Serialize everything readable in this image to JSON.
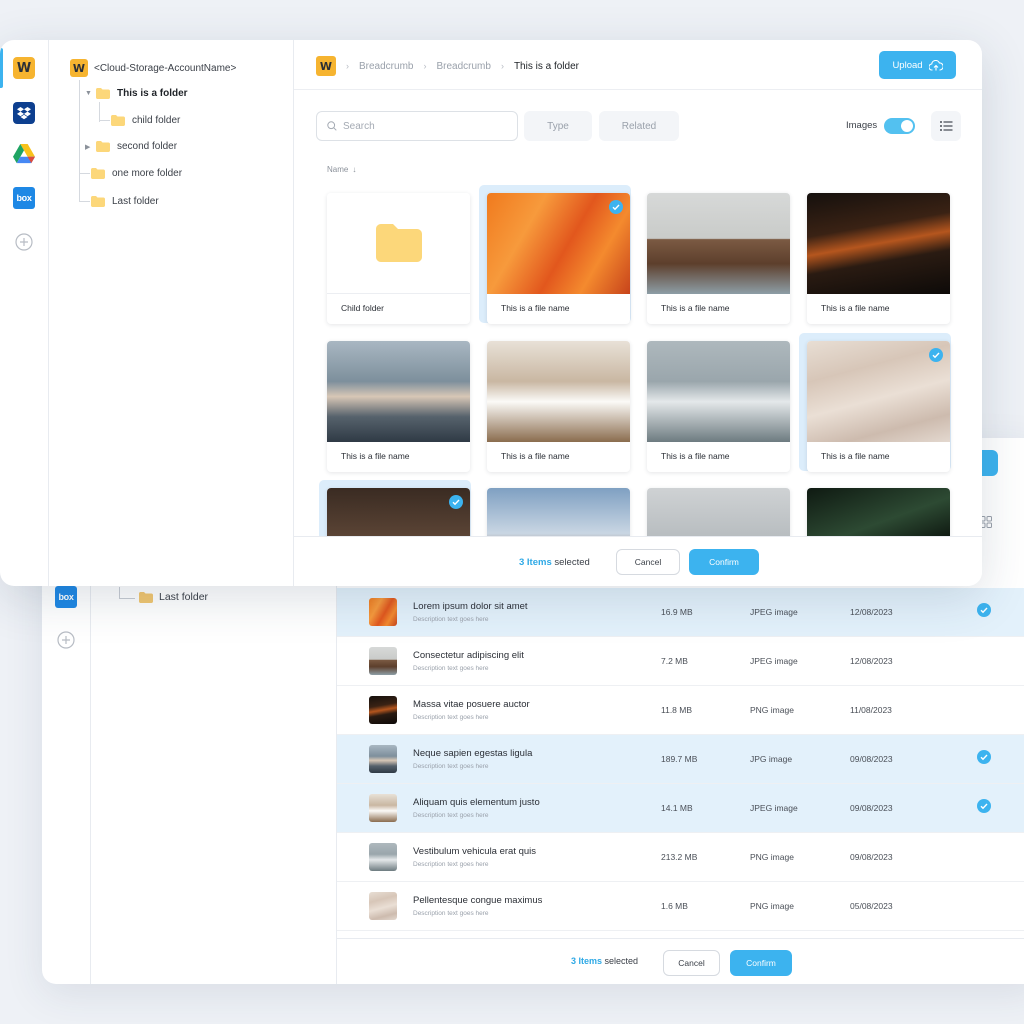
{
  "back_window": {
    "tree_item": "Last folder",
    "rail_box_label": "box",
    "rows": [
      {
        "name": "Lorem ipsum dolor sit amet",
        "desc": "Description text goes here",
        "size": "16.9 MB",
        "type": "JPEG image",
        "date": "12/08/2023",
        "selected": true,
        "thumb": "im-orange"
      },
      {
        "name": "Consectetur adipiscing elit",
        "desc": "Description text goes here",
        "size": "7.2 MB",
        "type": "JPEG image",
        "date": "12/08/2023",
        "selected": false,
        "thumb": "im-rock"
      },
      {
        "name": "Massa vitae posuere auctor",
        "desc": "Description text goes here",
        "size": "11.8 MB",
        "type": "PNG image",
        "date": "11/08/2023",
        "selected": false,
        "thumb": "im-dark"
      },
      {
        "name": "Neque sapien egestas ligula",
        "desc": "Description text goes here",
        "size": "189.7 MB",
        "type": "JPG image",
        "date": "09/08/2023",
        "selected": true,
        "thumb": "im-woman"
      },
      {
        "name": "Aliquam quis elementum justo",
        "desc": "Description text goes here",
        "size": "14.1 MB",
        "type": "JPEG image",
        "date": "09/08/2023",
        "selected": true,
        "thumb": "im-room"
      },
      {
        "name": "Vestibulum vehicula erat quis",
        "desc": "Description text goes here",
        "size": "213.2 MB",
        "type": "PNG image",
        "date": "09/08/2023",
        "selected": false,
        "thumb": "im-waves"
      },
      {
        "name": "Pellentesque congue maximus",
        "desc": "Description text goes here",
        "size": "1.6 MB",
        "type": "PNG image",
        "date": "05/08/2023",
        "selected": false,
        "thumb": "im-sand"
      }
    ],
    "footer": {
      "count": "3 Items",
      "count_suffix": " selected",
      "cancel": "Cancel",
      "confirm": "Confirm"
    }
  },
  "front_window": {
    "rail": {
      "items": [
        "w-logo",
        "dropbox-logo",
        "google-drive-logo",
        "box-logo",
        "add-icon"
      ],
      "w_label": "W",
      "box_label": "box"
    },
    "tree": {
      "root_label": "<Cloud-Storage-AccountName>",
      "items": [
        "This is a folder",
        "child folder",
        "second folder",
        "one more folder",
        "Last folder"
      ]
    },
    "breadcrumb": {
      "items": [
        "Breadcrumb",
        "Breadcrumb"
      ],
      "current": "This is a folder"
    },
    "upload_label": "Upload",
    "search_placeholder": "Search",
    "filters": {
      "type": "Type",
      "related": "Related"
    },
    "images_toggle": {
      "label": "Images",
      "on": true
    },
    "sort_label": "Name",
    "cards": [
      {
        "label": "Child folder",
        "kind": "folder",
        "selected": false
      },
      {
        "label": "This is a file name",
        "kind": "im-orange",
        "selected": true
      },
      {
        "label": "This is a file name",
        "kind": "im-rock",
        "selected": false
      },
      {
        "label": "This is a file name",
        "kind": "im-dark",
        "selected": false
      },
      {
        "label": "This is a file name",
        "kind": "im-woman",
        "selected": false
      },
      {
        "label": "This is a file name",
        "kind": "im-room",
        "selected": false
      },
      {
        "label": "This is a file name",
        "kind": "im-waves",
        "selected": false
      },
      {
        "label": "This is a file name",
        "kind": "im-sand",
        "selected": true
      },
      {
        "label": "",
        "kind": "im-brown",
        "selected": true
      },
      {
        "label": "",
        "kind": "im-mountain",
        "selected": false
      },
      {
        "label": "",
        "kind": "im-surf",
        "selected": false
      },
      {
        "label": "",
        "kind": "im-leaf",
        "selected": false
      }
    ],
    "footer": {
      "count": "3 Items",
      "count_suffix": " selected",
      "cancel": "Cancel",
      "confirm": "Confirm"
    }
  },
  "colors": {
    "accent": "#3cb3ef",
    "selected_bg": "#e3f1fb",
    "folder": "#fcd77a",
    "w_logo": "#f6b430"
  }
}
